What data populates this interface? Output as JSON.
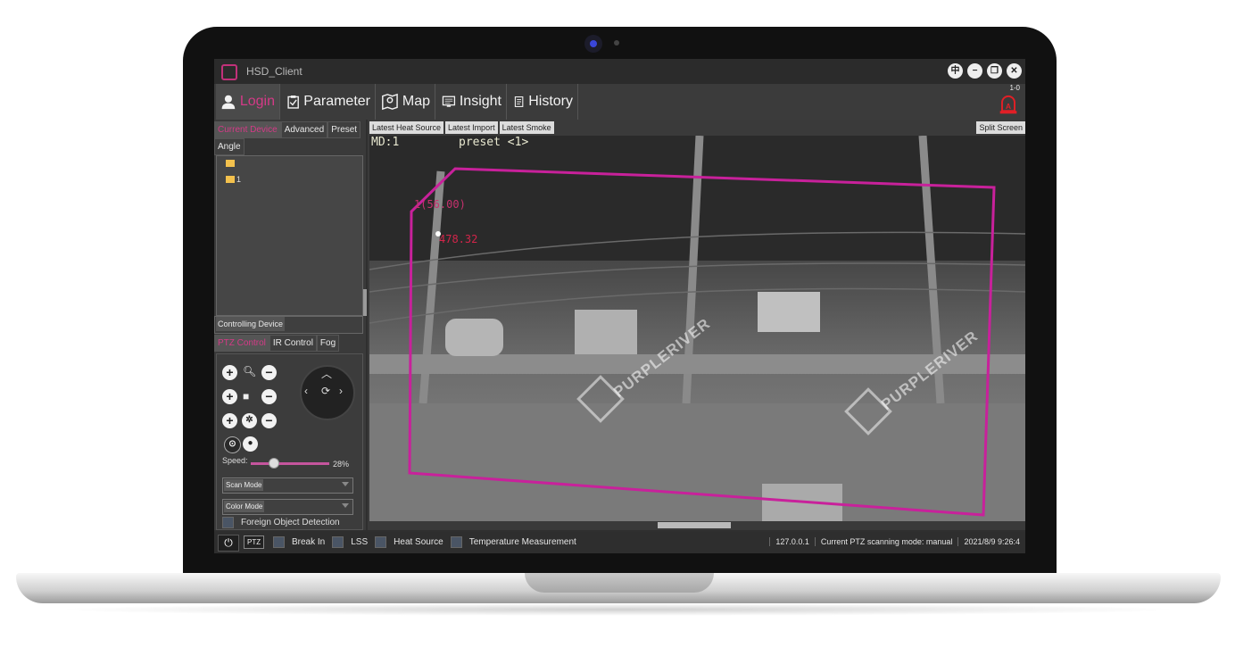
{
  "app": {
    "title": "HSD_Client"
  },
  "window_controls": [
    {
      "name": "language-button",
      "label": "中"
    },
    {
      "name": "minimize-button",
      "label": "−"
    },
    {
      "name": "restore-button",
      "label": "❐"
    },
    {
      "name": "close-button",
      "label": "✕"
    }
  ],
  "menu": {
    "items": [
      {
        "label": "Login",
        "icon": "user-icon",
        "active": true
      },
      {
        "label": "Parameter",
        "icon": "clipboard-icon"
      },
      {
        "label": "Map",
        "icon": "map-icon"
      },
      {
        "label": "Insight",
        "icon": "monitor-icon"
      },
      {
        "label": "History",
        "icon": "document-icon"
      }
    ],
    "alarm_count": "1-0",
    "alarm_icon": "alarm-icon"
  },
  "left": {
    "tabs": [
      "Current Device",
      "Advanced",
      "Preset"
    ],
    "angle_tab": "Angle",
    "tree": [
      {
        "label": ""
      },
      {
        "label": "1"
      }
    ],
    "controlling_device": "Controlling Device",
    "ptz_tabs": [
      "PTZ Control",
      "IR Control",
      "Fog"
    ],
    "ptz": {
      "speed_label": "Speed:",
      "speed_value": "28%",
      "speed": 28,
      "scan_mode_label": "Scan Mode",
      "color_mode_label": "Color Mode",
      "foreign_object": "Foreign Object Detection"
    }
  },
  "video": {
    "tabs": [
      "Latest Heat Source",
      "Latest Import",
      "Latest Smoke"
    ],
    "split_screen": "Split Screen",
    "osd_md": "MD:1",
    "osd_preset": "preset <1>",
    "temp_label": "1(56.00)",
    "temp_value": "478.32",
    "watermark": "PURPLERIVER",
    "accent": "#c8219b"
  },
  "status": {
    "ptz_badge": "PTZ",
    "items": [
      "Break In",
      "LSS",
      "Heat Source",
      "Temperature Measurement"
    ],
    "ip": "127.0.0.1",
    "scan_mode": "Current PTZ scanning mode: manual",
    "datetime": "2021/8/9 9:26:4"
  },
  "colors": {
    "accent": "#d43a87",
    "checkbox": "#4a5565"
  }
}
